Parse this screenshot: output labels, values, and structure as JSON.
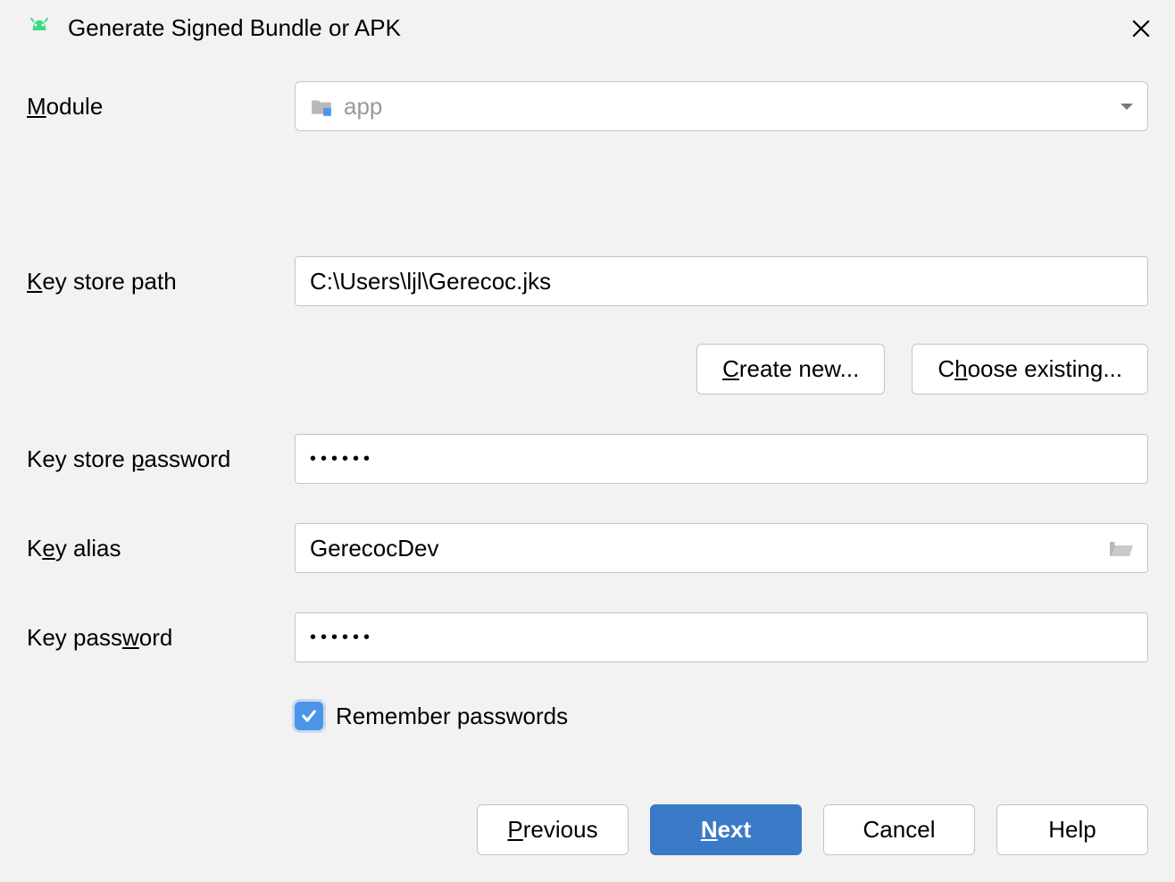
{
  "dialog": {
    "title": "Generate Signed Bundle or APK"
  },
  "form": {
    "module_label": "Module",
    "module_value": "app",
    "keystore_path_label": "Key store path",
    "keystore_path_value": "C:\\Users\\ljl\\Gerecoc.jks",
    "create_new_label": "Create new...",
    "choose_existing_label": "Choose existing...",
    "keystore_password_label": "Key store password",
    "keystore_password_value": "••••••",
    "key_alias_label": "Key alias",
    "key_alias_value": "GerecocDev",
    "key_password_label": "Key password",
    "key_password_value": "••••••",
    "remember_passwords_label": "Remember passwords",
    "remember_passwords_checked": true
  },
  "footer": {
    "previous_label": "Previous",
    "next_label": "Next",
    "cancel_label": "Cancel",
    "help_label": "Help"
  }
}
